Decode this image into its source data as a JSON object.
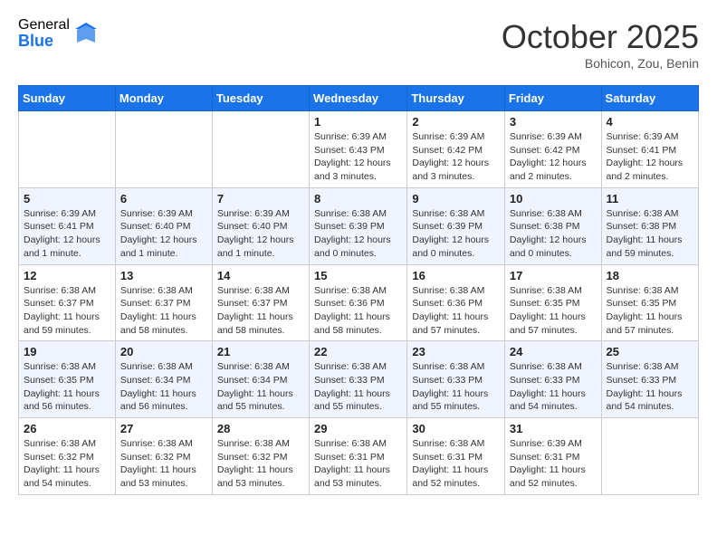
{
  "header": {
    "logo_general": "General",
    "logo_blue": "Blue",
    "month": "October 2025",
    "location": "Bohicon, Zou, Benin"
  },
  "weekdays": [
    "Sunday",
    "Monday",
    "Tuesday",
    "Wednesday",
    "Thursday",
    "Friday",
    "Saturday"
  ],
  "weeks": [
    [
      null,
      null,
      null,
      {
        "day": "1",
        "sunrise": "6:39 AM",
        "sunset": "6:43 PM",
        "daylight": "12 hours and 3 minutes."
      },
      {
        "day": "2",
        "sunrise": "6:39 AM",
        "sunset": "6:42 PM",
        "daylight": "12 hours and 3 minutes."
      },
      {
        "day": "3",
        "sunrise": "6:39 AM",
        "sunset": "6:42 PM",
        "daylight": "12 hours and 2 minutes."
      },
      {
        "day": "4",
        "sunrise": "6:39 AM",
        "sunset": "6:41 PM",
        "daylight": "12 hours and 2 minutes."
      }
    ],
    [
      {
        "day": "5",
        "sunrise": "6:39 AM",
        "sunset": "6:41 PM",
        "daylight": "12 hours and 1 minute."
      },
      {
        "day": "6",
        "sunrise": "6:39 AM",
        "sunset": "6:40 PM",
        "daylight": "12 hours and 1 minute."
      },
      {
        "day": "7",
        "sunrise": "6:39 AM",
        "sunset": "6:40 PM",
        "daylight": "12 hours and 1 minute."
      },
      {
        "day": "8",
        "sunrise": "6:38 AM",
        "sunset": "6:39 PM",
        "daylight": "12 hours and 0 minutes."
      },
      {
        "day": "9",
        "sunrise": "6:38 AM",
        "sunset": "6:39 PM",
        "daylight": "12 hours and 0 minutes."
      },
      {
        "day": "10",
        "sunrise": "6:38 AM",
        "sunset": "6:38 PM",
        "daylight": "12 hours and 0 minutes."
      },
      {
        "day": "11",
        "sunrise": "6:38 AM",
        "sunset": "6:38 PM",
        "daylight": "11 hours and 59 minutes."
      }
    ],
    [
      {
        "day": "12",
        "sunrise": "6:38 AM",
        "sunset": "6:37 PM",
        "daylight": "11 hours and 59 minutes."
      },
      {
        "day": "13",
        "sunrise": "6:38 AM",
        "sunset": "6:37 PM",
        "daylight": "11 hours and 58 minutes."
      },
      {
        "day": "14",
        "sunrise": "6:38 AM",
        "sunset": "6:37 PM",
        "daylight": "11 hours and 58 minutes."
      },
      {
        "day": "15",
        "sunrise": "6:38 AM",
        "sunset": "6:36 PM",
        "daylight": "11 hours and 58 minutes."
      },
      {
        "day": "16",
        "sunrise": "6:38 AM",
        "sunset": "6:36 PM",
        "daylight": "11 hours and 57 minutes."
      },
      {
        "day": "17",
        "sunrise": "6:38 AM",
        "sunset": "6:35 PM",
        "daylight": "11 hours and 57 minutes."
      },
      {
        "day": "18",
        "sunrise": "6:38 AM",
        "sunset": "6:35 PM",
        "daylight": "11 hours and 57 minutes."
      }
    ],
    [
      {
        "day": "19",
        "sunrise": "6:38 AM",
        "sunset": "6:35 PM",
        "daylight": "11 hours and 56 minutes."
      },
      {
        "day": "20",
        "sunrise": "6:38 AM",
        "sunset": "6:34 PM",
        "daylight": "11 hours and 56 minutes."
      },
      {
        "day": "21",
        "sunrise": "6:38 AM",
        "sunset": "6:34 PM",
        "daylight": "11 hours and 55 minutes."
      },
      {
        "day": "22",
        "sunrise": "6:38 AM",
        "sunset": "6:33 PM",
        "daylight": "11 hours and 55 minutes."
      },
      {
        "day": "23",
        "sunrise": "6:38 AM",
        "sunset": "6:33 PM",
        "daylight": "11 hours and 55 minutes."
      },
      {
        "day": "24",
        "sunrise": "6:38 AM",
        "sunset": "6:33 PM",
        "daylight": "11 hours and 54 minutes."
      },
      {
        "day": "25",
        "sunrise": "6:38 AM",
        "sunset": "6:33 PM",
        "daylight": "11 hours and 54 minutes."
      }
    ],
    [
      {
        "day": "26",
        "sunrise": "6:38 AM",
        "sunset": "6:32 PM",
        "daylight": "11 hours and 54 minutes."
      },
      {
        "day": "27",
        "sunrise": "6:38 AM",
        "sunset": "6:32 PM",
        "daylight": "11 hours and 53 minutes."
      },
      {
        "day": "28",
        "sunrise": "6:38 AM",
        "sunset": "6:32 PM",
        "daylight": "11 hours and 53 minutes."
      },
      {
        "day": "29",
        "sunrise": "6:38 AM",
        "sunset": "6:31 PM",
        "daylight": "11 hours and 53 minutes."
      },
      {
        "day": "30",
        "sunrise": "6:38 AM",
        "sunset": "6:31 PM",
        "daylight": "11 hours and 52 minutes."
      },
      {
        "day": "31",
        "sunrise": "6:39 AM",
        "sunset": "6:31 PM",
        "daylight": "11 hours and 52 minutes."
      },
      null
    ]
  ]
}
